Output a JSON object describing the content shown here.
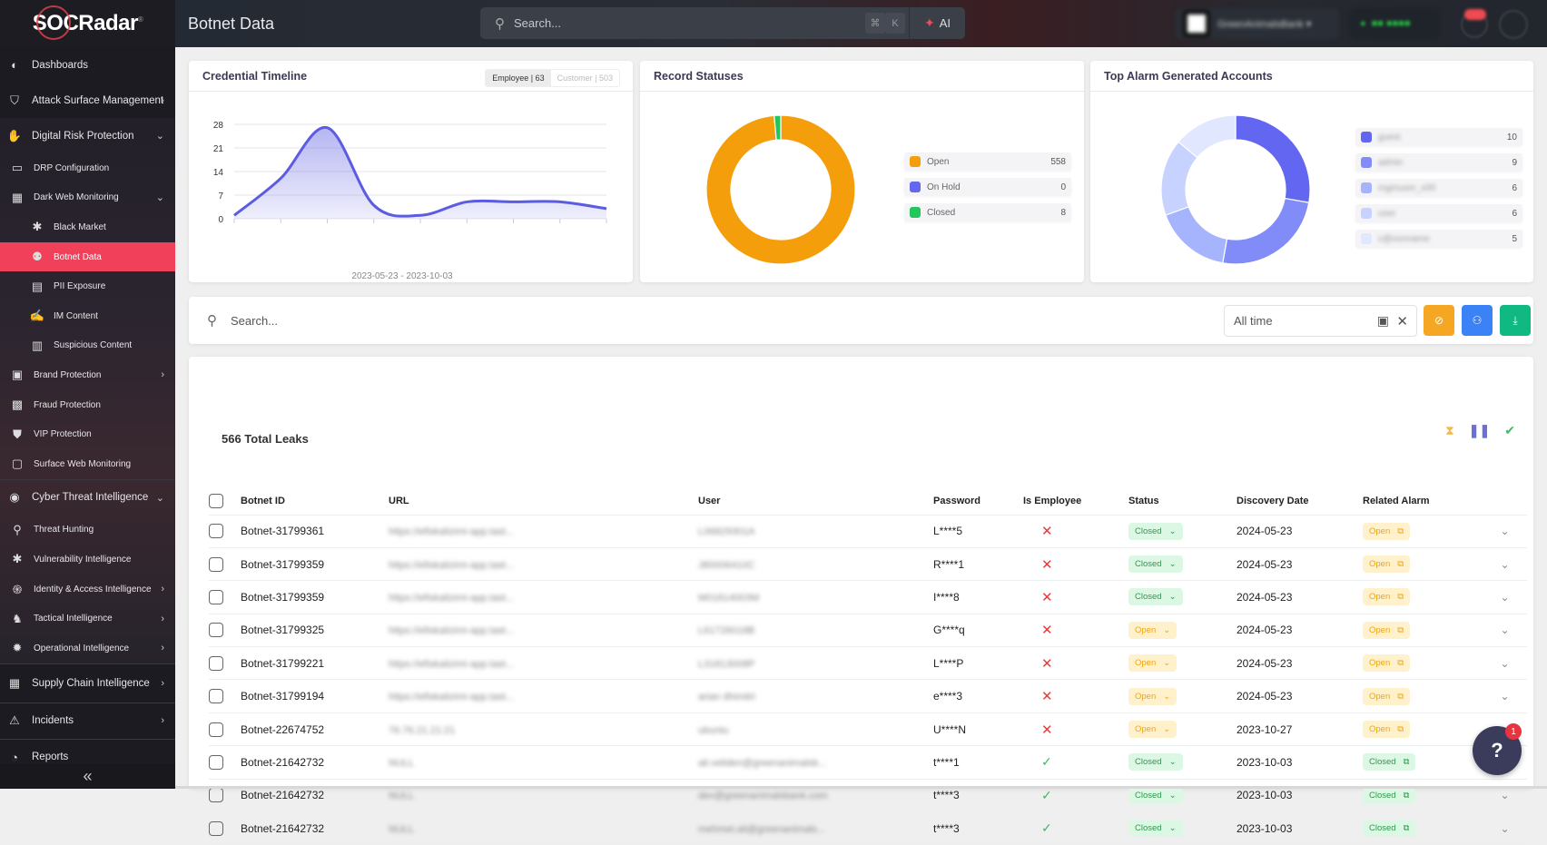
{
  "app": {
    "logo": "SOCRadar",
    "logo_mark": "®"
  },
  "sidebar": {
    "items": [
      {
        "label": "Dashboards",
        "icon": "dashboard-icon"
      },
      {
        "label": "Attack Surface Management",
        "icon": "shield-scan-icon"
      },
      {
        "label": "Digital Risk Protection",
        "icon": "hand-shield-icon"
      },
      {
        "label": "DRP Configuration",
        "icon": "laptop-icon"
      },
      {
        "label": "Dark Web Monitoring",
        "icon": "building-icon"
      },
      {
        "label": "Black Market",
        "icon": "bug-icon"
      },
      {
        "label": "Botnet Data",
        "icon": "botnet-icon"
      },
      {
        "label": "PII Exposure",
        "icon": "id-card-icon"
      },
      {
        "label": "IM Content",
        "icon": "chat-hand-icon"
      },
      {
        "label": "Suspicious Content",
        "icon": "document-icon"
      },
      {
        "label": "Brand Protection",
        "icon": "brand-icon"
      },
      {
        "label": "Fraud Protection",
        "icon": "fraud-icon"
      },
      {
        "label": "VIP Protection",
        "icon": "vip-shield-icon"
      },
      {
        "label": "Surface Web Monitoring",
        "icon": "folder-lock-icon"
      },
      {
        "label": "Cyber Threat Intelligence",
        "icon": "eye-shield-icon"
      },
      {
        "label": "Threat Hunting",
        "icon": "search-icon"
      },
      {
        "label": "Vulnerability Intelligence",
        "icon": "bug-icon"
      },
      {
        "label": "Identity & Access Intelligence",
        "icon": "fingerprint-icon"
      },
      {
        "label": "Tactical Intelligence",
        "icon": "chess-knight-icon"
      },
      {
        "label": "Operational Intelligence",
        "icon": "virus-icon"
      },
      {
        "label": "Supply Chain Intelligence",
        "icon": "supply-chain-icon"
      },
      {
        "label": "Incidents",
        "icon": "alert-monitor-icon"
      },
      {
        "label": "Reports",
        "icon": "report-chart-icon"
      }
    ],
    "collapse_label": "«"
  },
  "topbar": {
    "title": "Botnet Data",
    "search_placeholder": "Search...",
    "kbd_cmd": "⌘",
    "kbd_k": "K",
    "ai_label": "AI"
  },
  "cards": {
    "timeline": {
      "title": "Credential Timeline",
      "seg_employee": "Employee | 63",
      "seg_customer": "Customer | 503",
      "range": "2023-05-23 - 2023-10-03"
    },
    "statuses": {
      "title": "Record Statuses"
    },
    "accounts": {
      "title": "Top Alarm Generated Accounts"
    }
  },
  "chart_data": [
    {
      "type": "area",
      "title": "Credential Timeline",
      "yticks": [
        0,
        7,
        14,
        21,
        28
      ],
      "ylim": [
        0,
        28
      ],
      "values": [
        1,
        12,
        27,
        4,
        1,
        5,
        5,
        5,
        3
      ],
      "xlabel": "2023-05-23 - 2023-10-03",
      "color": "#5b5ce2",
      "grid": true
    },
    {
      "type": "pie",
      "title": "Record Statuses",
      "categories": [
        "Open",
        "On Hold",
        "Closed"
      ],
      "values": [
        558,
        0,
        8
      ],
      "colors": [
        "#f59e0b",
        "#6366f1",
        "#22c55e"
      ],
      "legend": "right"
    },
    {
      "type": "pie",
      "title": "Top Alarm Generated Accounts",
      "categories": [
        "guest",
        "admin",
        "mgmuser_x00",
        "user",
        "c@nonname"
      ],
      "values": [
        10,
        9,
        6,
        6,
        5
      ],
      "colors": [
        "#6366f1",
        "#818cf8",
        "#a5b4fc",
        "#c7d2fe",
        "#e0e7ff"
      ],
      "legend": "right"
    }
  ],
  "filter": {
    "search_placeholder": "Search...",
    "date_value": "All time",
    "buttons": [
      {
        "name": "hide-filter-button",
        "color": "#f5a623",
        "icon": "⊘"
      },
      {
        "name": "user-history-button",
        "color": "#3b82f6",
        "icon": "⚇"
      },
      {
        "name": "download-button",
        "color": "#10b981",
        "icon": "⤓"
      }
    ]
  },
  "table": {
    "total_label": "566 Total Leaks",
    "columns": [
      "Botnet ID",
      "URL",
      "User",
      "Password",
      "Is Employee",
      "Status",
      "Discovery Date",
      "Related Alarm"
    ],
    "rows": [
      {
        "id": "Botnet-31799361",
        "url": "https://efiskalizimi-app.tast...",
        "user": "L06829301A",
        "password": "L****5",
        "employee": false,
        "status": "Closed",
        "date": "2024-05-23",
        "alarm": "Open"
      },
      {
        "id": "Botnet-31799359",
        "url": "https://efiskalizimi-app.tast...",
        "user": "J80006410C",
        "password": "R****1",
        "employee": false,
        "status": "Closed",
        "date": "2024-05-23",
        "alarm": "Open"
      },
      {
        "id": "Botnet-31799359",
        "url": "https://efiskalizimi-app.tast...",
        "user": "M01814003M",
        "password": "I****8",
        "employee": false,
        "status": "Closed",
        "date": "2024-05-23",
        "alarm": "Open"
      },
      {
        "id": "Botnet-31799325",
        "url": "https://efiskalizimi-app.tast...",
        "user": "L61726018B",
        "password": "G****q",
        "employee": false,
        "status": "Open",
        "date": "2024-05-23",
        "alarm": "Open"
      },
      {
        "id": "Botnet-31799221",
        "url": "https://efiskalizimi-app.tast...",
        "user": "L31813008P",
        "password": "L****P",
        "employee": false,
        "status": "Open",
        "date": "2024-05-23",
        "alarm": "Open"
      },
      {
        "id": "Botnet-31799194",
        "url": "https://efiskalizimi-app.tast...",
        "user": "arian dhimitri",
        "password": "e****3",
        "employee": false,
        "status": "Open",
        "date": "2024-05-23",
        "alarm": "Open"
      },
      {
        "id": "Botnet-22674752",
        "url": "76.76.21.21:21",
        "user": "ubuntu",
        "password": "U****N",
        "employee": false,
        "status": "Open",
        "date": "2023-10-27",
        "alarm": "Open"
      },
      {
        "id": "Botnet-21642732",
        "url": "NULL",
        "user": "ali.veliden@greenanimalsb...",
        "password": "t****1",
        "employee": true,
        "status": "Closed",
        "date": "2023-10-03",
        "alarm": "Closed"
      },
      {
        "id": "Botnet-21642732",
        "url": "NULL",
        "user": "dev@greenanimalsbank.com",
        "password": "t****3",
        "employee": true,
        "status": "Closed",
        "date": "2023-10-03",
        "alarm": "Closed"
      },
      {
        "id": "Botnet-21642732",
        "url": "NULL",
        "user": "mehmet.ali@greenanimals...",
        "password": "t****3",
        "employee": true,
        "status": "Closed",
        "date": "2023-10-03",
        "alarm": "Closed"
      }
    ]
  },
  "help": {
    "badge": "1",
    "icon": "?"
  },
  "status_colors": {
    "open": "#f0a516",
    "closed": "#2f9a4c",
    "accent": "#f0405a"
  }
}
